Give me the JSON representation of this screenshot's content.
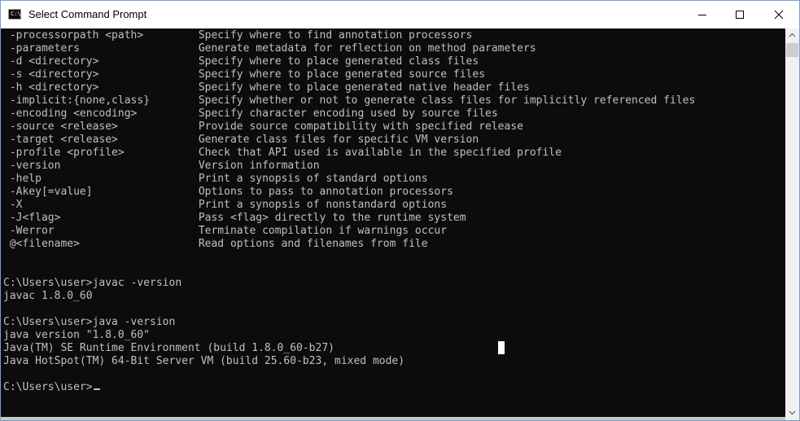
{
  "window": {
    "title": "Select Command Prompt",
    "icon": "cmd-icon",
    "icon_text": "C:\\"
  },
  "controls": {
    "minimize": "minimize-icon",
    "maximize": "maximize-icon",
    "close": "close-icon"
  },
  "options": [
    {
      "flag": "-processorpath <path>",
      "desc": "Specify where to find annotation processors"
    },
    {
      "flag": "-parameters",
      "desc": "Generate metadata for reflection on method parameters"
    },
    {
      "flag": "-d <directory>",
      "desc": "Specify where to place generated class files"
    },
    {
      "flag": "-s <directory>",
      "desc": "Specify where to place generated source files"
    },
    {
      "flag": "-h <directory>",
      "desc": "Specify where to place generated native header files"
    },
    {
      "flag": "-implicit:{none,class}",
      "desc": "Specify whether or not to generate class files for implicitly referenced files"
    },
    {
      "flag": "-encoding <encoding>",
      "desc": "Specify character encoding used by source files"
    },
    {
      "flag": "-source <release>",
      "desc": "Provide source compatibility with specified release"
    },
    {
      "flag": "-target <release>",
      "desc": "Generate class files for specific VM version"
    },
    {
      "flag": "-profile <profile>",
      "desc": "Check that API used is available in the specified profile"
    },
    {
      "flag": "-version",
      "desc": "Version information"
    },
    {
      "flag": "-help",
      "desc": "Print a synopsis of standard options"
    },
    {
      "flag": "-Akey[=value]",
      "desc": "Options to pass to annotation processors"
    },
    {
      "flag": "-X",
      "desc": "Print a synopsis of nonstandard options"
    },
    {
      "flag": "-J<flag>",
      "desc": "Pass <flag> directly to the runtime system"
    },
    {
      "flag": "-Werror",
      "desc": "Terminate compilation if warnings occur"
    },
    {
      "flag": "@<filename>",
      "desc": "Read options and filenames from file"
    }
  ],
  "session": {
    "javac_cmd": "C:\\Users\\user>javac -version",
    "javac_out": "javac 1.8.0_60",
    "java_cmd": "C:\\Users\\user>java -version",
    "java_out_1": "java version \"1.8.0_60\"",
    "java_out_2": "Java(TM) SE Runtime Environment (build 1.8.0_60-b27)",
    "java_out_3": "Java HotSpot(TM) 64-Bit Server VM (build 25.60-b23, mixed mode)",
    "prompt": "C:\\Users\\user>"
  },
  "colors": {
    "console_bg": "#0c0c0c",
    "console_fg": "#c0c0c0"
  }
}
